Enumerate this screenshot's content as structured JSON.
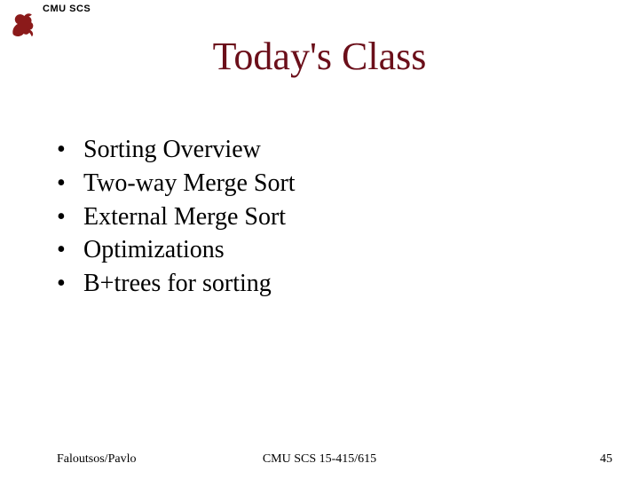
{
  "header": {
    "org": "CMU SCS"
  },
  "title": "Today's Class",
  "bullets": [
    "Sorting Overview",
    "Two-way Merge Sort",
    "External Merge Sort",
    "Optimizations",
    "B+trees for sorting"
  ],
  "footer": {
    "left": "Faloutsos/Pavlo",
    "center": "CMU SCS 15-415/615",
    "right": "45"
  }
}
